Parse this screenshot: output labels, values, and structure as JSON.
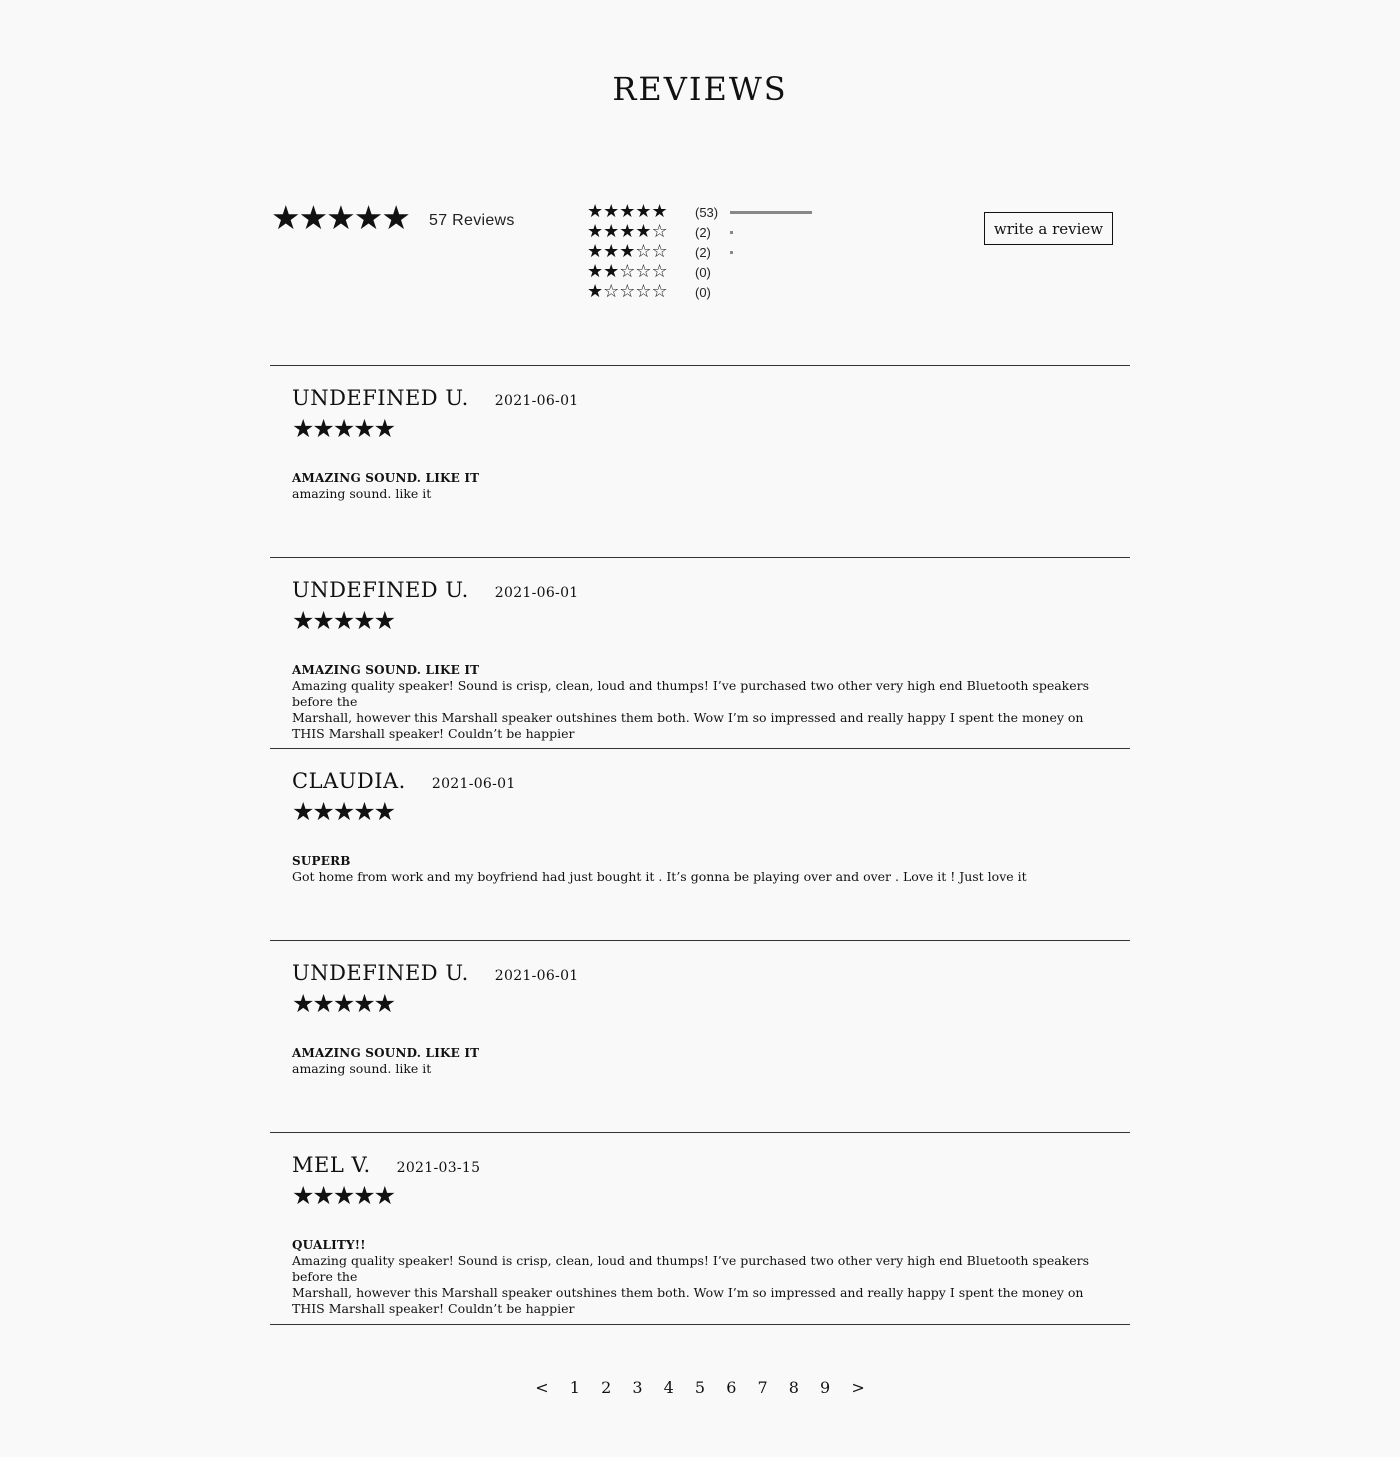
{
  "page_title": "REVIEWS",
  "summary": {
    "stars": "★★★★★",
    "count_label": "57 Reviews"
  },
  "breakdown": [
    {
      "stars": "★★★★★",
      "count": "(53)",
      "fraction": 0.93
    },
    {
      "stars": "★★★★☆",
      "count": "(2)",
      "fraction": 0.035
    },
    {
      "stars": "★★★☆☆",
      "count": "(2)",
      "fraction": 0.035
    },
    {
      "stars": "★★☆☆☆",
      "count": "(0)",
      "fraction": 0
    },
    {
      "stars": "★☆☆☆☆",
      "count": "(0)",
      "fraction": 0
    }
  ],
  "write_review_label": "write a review",
  "reviews": [
    {
      "name": "UNDEFINED U.",
      "date": "2021-06-01",
      "stars": "★★★★★",
      "title": "AMAZING SOUND. LIKE IT",
      "body": "amazing sound. like it"
    },
    {
      "name": "UNDEFINED U.",
      "date": "2021-06-01",
      "stars": "★★★★★",
      "title": "AMAZING SOUND. LIKE IT",
      "body": "Amazing quality speaker! Sound is crisp, clean, loud and thumps! I’ve purchased two other very high end Bluetooth speakers before the\nMarshall, however this Marshall speaker outshines them both. Wow I’m so impressed and really happy I spent the money on\nTHIS Marshall speaker! Couldn’t be happier"
    },
    {
      "name": "CLAUDIA.",
      "date": "2021-06-01",
      "stars": "★★★★★",
      "title": "SUPERB",
      "body": "Got home from work and my boyfriend had just bought it . It’s gonna be playing over and over . Love it ! Just love it"
    },
    {
      "name": "UNDEFINED U.",
      "date": "2021-06-01",
      "stars": "★★★★★",
      "title": "AMAZING SOUND. LIKE IT",
      "body": "amazing sound. like it"
    },
    {
      "name": "MEL V.",
      "date": "2021-03-15",
      "stars": "★★★★★",
      "title": "QUALITY!!",
      "body": "Amazing quality speaker! Sound is crisp, clean, loud and thumps! I’ve purchased two other very high end Bluetooth speakers before the\nMarshall, however this Marshall speaker outshines them both. Wow I’m so impressed and really happy I spent the money on\nTHIS Marshall speaker! Couldn’t be happier"
    }
  ],
  "pagination": {
    "prev": "<",
    "pages": [
      "1",
      "2",
      "3",
      "4",
      "5",
      "6",
      "7",
      "8",
      "9"
    ],
    "next": ">"
  }
}
